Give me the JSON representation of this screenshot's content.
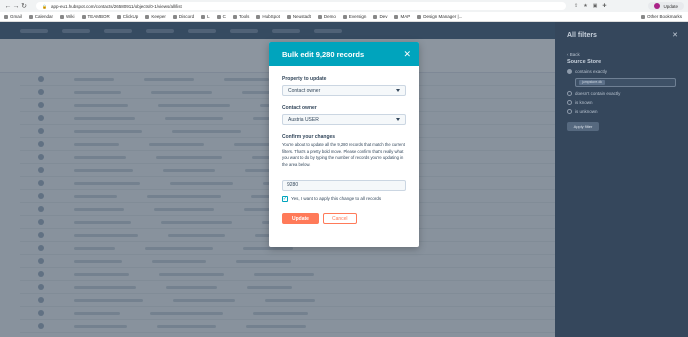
{
  "browser": {
    "url": "app-eu1.hubspot.com/contacts/26580911/objects/0-1/views/all/list",
    "update_label": "Update"
  },
  "bookmarks": [
    "Gmail",
    "Calendar",
    "Wiki",
    "TEAMBOR",
    "ClickUp",
    "Keeper",
    "Discord",
    "L",
    "C",
    "Tools",
    "HubSpot",
    "Neustadt",
    "Demo",
    "Eversign",
    "Dev",
    "MAP",
    "Design Manager |..."
  ],
  "other_bookmarks": "Other Bookmarks",
  "filter_panel": {
    "title": "All filters",
    "back": "Back",
    "subtitle": "Source Store",
    "options": [
      "contains exactly",
      "doesn't contain exactly",
      "is known",
      "is unknown"
    ],
    "chip": "jumpstore.dk",
    "apply": "Apply filter"
  },
  "modal": {
    "title": "Bulk edit 9,280 records",
    "property_label": "Property to update",
    "property_value": "Contact owner",
    "owner_label": "Contact owner",
    "owner_value": "Austria USER",
    "confirm_title": "Confirm your changes",
    "confirm_text": "You're about to update all the 9,280 records that match the current filters. That's a pretty bold move. Please confirm that's really what you want to do by typing the number of records you're updating in the area below.",
    "input_value": "9280",
    "checkbox_label": "Yes, I want to apply this change to all records",
    "update_label": "Update",
    "cancel_label": "Cancel"
  },
  "colors": {
    "header": "#00a4bd",
    "primary": "#ff7a59"
  }
}
